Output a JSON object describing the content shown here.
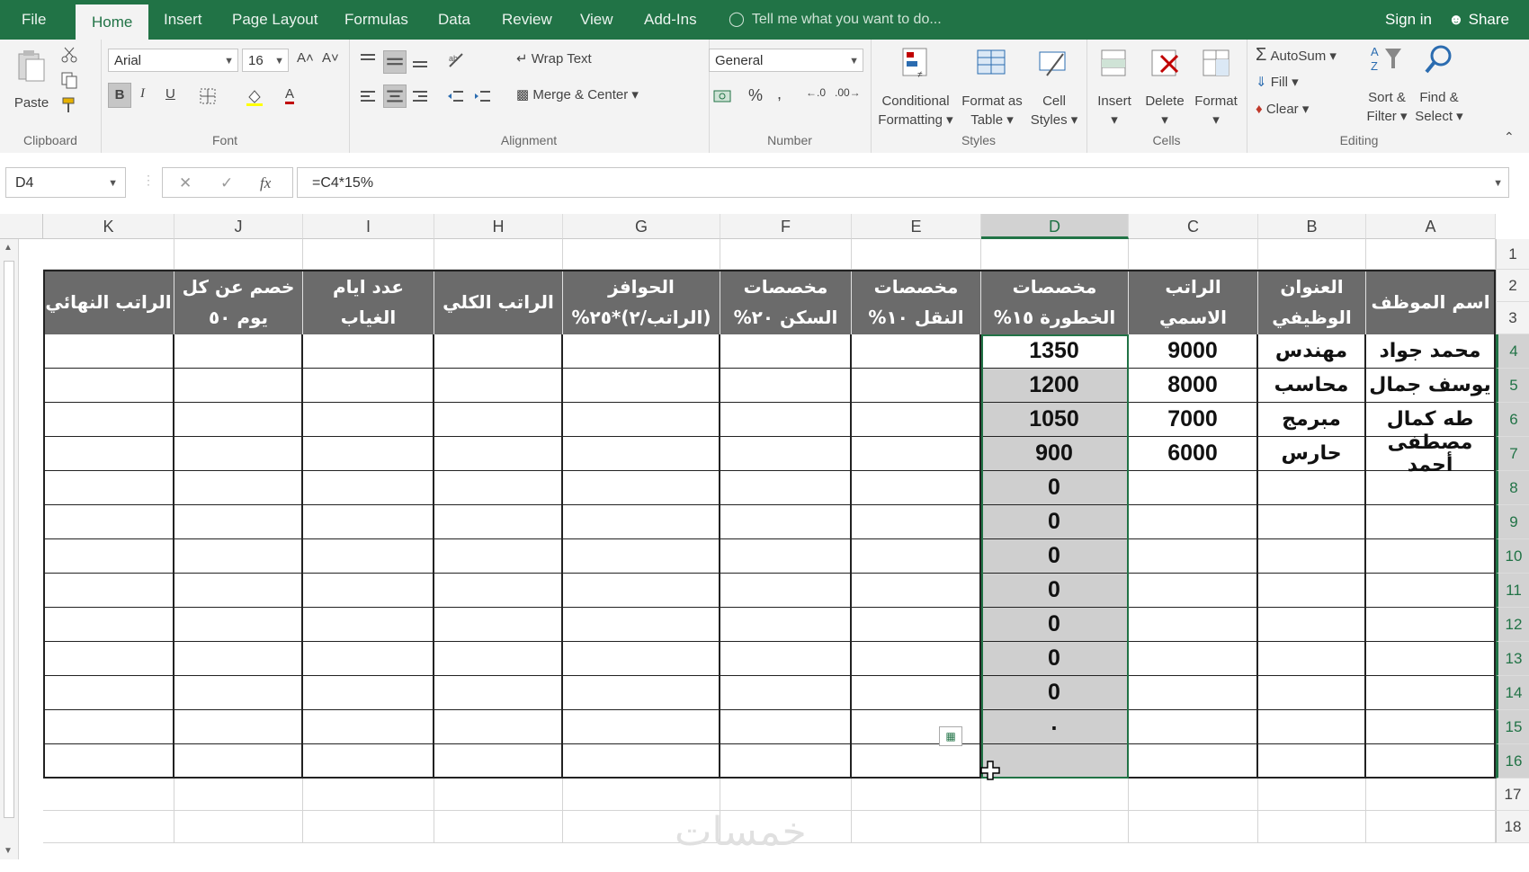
{
  "tabs": [
    "File",
    "Home",
    "Insert",
    "Page Layout",
    "Formulas",
    "Data",
    "Review",
    "View",
    "Add-Ins"
  ],
  "tell_me": "Tell me what you want to do...",
  "sign_in": "Sign in",
  "share": "Share",
  "ribbon": {
    "clipboard": {
      "paste": "Paste",
      "label": "Clipboard"
    },
    "font": {
      "name": "Arial",
      "size": "16",
      "bold": "B",
      "italic": "I",
      "underline": "U",
      "grow": "A˄",
      "shrink": "A˅",
      "color": "A",
      "label": "Font"
    },
    "alignment": {
      "wrap": "Wrap Text",
      "merge": "Merge & Center",
      "label": "Alignment"
    },
    "number": {
      "format": "General",
      "percent": "%",
      "comma": ",",
      "label": "Number"
    },
    "styles": {
      "conditional": "Conditional",
      "conditional2": "Formatting",
      "format_table": "Format as",
      "format_table2": "Table",
      "cell_styles": "Cell",
      "cell_styles2": "Styles",
      "label": "Styles"
    },
    "cells": {
      "insert": "Insert",
      "delete": "Delete",
      "format": "Format",
      "label": "Cells"
    },
    "editing": {
      "autosum": "AutoSum",
      "fill": "Fill",
      "clear": "Clear",
      "sort": "Sort &",
      "sort2": "Filter",
      "find": "Find &",
      "find2": "Select",
      "label": "Editing"
    }
  },
  "name_box": "D4",
  "formula": "=C4*15%",
  "fx": "fx",
  "columns": [
    "K",
    "J",
    "I",
    "H",
    "G",
    "F",
    "E",
    "D",
    "C",
    "B",
    "A"
  ],
  "rows": [
    "1",
    "2",
    "3",
    "4",
    "5",
    "6",
    "7",
    "8",
    "9",
    "10",
    "11",
    "12",
    "13",
    "14",
    "15",
    "16",
    "17",
    "18"
  ],
  "table": {
    "headers": {
      "K": [
        "الراتب النهائي"
      ],
      "J": [
        "خصم عن كل",
        "يوم ٥٠"
      ],
      "I": [
        "عدد ايام",
        "الغياب"
      ],
      "H": [
        "الراتب الكلي"
      ],
      "G": [
        "الحوافز",
        "(الراتب/٢)*٢٥%"
      ],
      "F": [
        "مخصصات",
        "السكن ٢٠%"
      ],
      "E": [
        "مخصصات",
        "النقل ١٠%"
      ],
      "D": [
        "مخصصات",
        "الخطورة ١٥%"
      ],
      "C": [
        "الراتب الاسمي"
      ],
      "B": [
        "العنوان",
        "الوظيفي"
      ],
      "A": [
        "اسم الموظف"
      ]
    },
    "employees": [
      {
        "A": "محمد جواد",
        "B": "مهندس",
        "C": "9000",
        "D": "1350"
      },
      {
        "A": "يوسف جمال",
        "B": "محاسب",
        "C": "8000",
        "D": "1200"
      },
      {
        "A": "طه كمال",
        "B": "مبرمج",
        "C": "7000",
        "D": "1050"
      },
      {
        "A": "مصطفى أحمد",
        "B": "حارس",
        "C": "6000",
        "D": "900"
      }
    ],
    "d_filled": [
      "0",
      "0",
      "0",
      "0",
      "0",
      "0",
      "0",
      "٠"
    ]
  },
  "watermark": "خمسات",
  "colors": {
    "accent": "#217346",
    "header_fill": "#6b6b6b",
    "selection_fill": "#cfcfcf"
  }
}
